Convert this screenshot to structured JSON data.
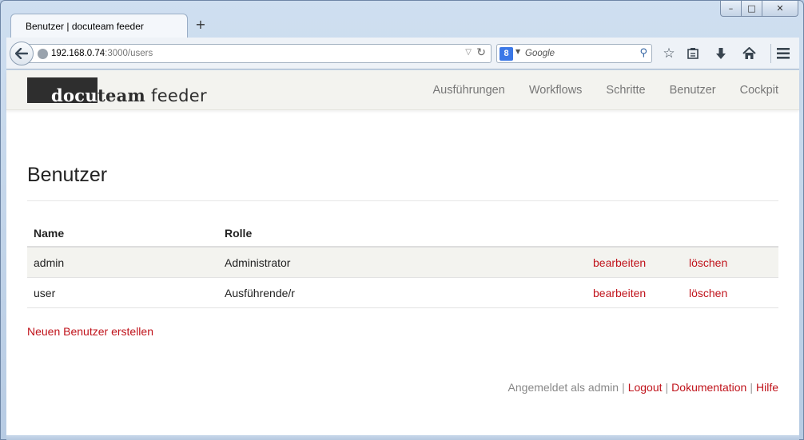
{
  "browser": {
    "tab_title": "Benutzer | docuteam feeder",
    "new_tab_icon": "plus-icon",
    "url_host": "192.168.0.74",
    "url_path": ":3000/users",
    "search_placeholder": "Google",
    "search_engine_badge": "8",
    "caption": {
      "minimize": "–",
      "maximize": "□",
      "close": "✕"
    },
    "toolbar_icons": [
      "star-icon",
      "reading-list-icon",
      "download-icon",
      "home-icon",
      "menu-icon"
    ]
  },
  "site": {
    "logo": {
      "docu": "docu",
      "team": "team",
      "feeder": " feeder"
    },
    "nav": [
      {
        "label": "Ausführungen"
      },
      {
        "label": "Workflows"
      },
      {
        "label": "Schritte"
      },
      {
        "label": "Benutzer"
      },
      {
        "label": "Cockpit"
      }
    ]
  },
  "page": {
    "title": "Benutzer",
    "table": {
      "headers": {
        "name": "Name",
        "role": "Rolle"
      },
      "rows": [
        {
          "name": "admin",
          "role": "Administrator",
          "edit": "bearbeiten",
          "delete": "löschen"
        },
        {
          "name": "user",
          "role": "Ausführende/r",
          "edit": "bearbeiten",
          "delete": "löschen"
        }
      ]
    },
    "new_user_link": "Neuen Benutzer erstellen"
  },
  "footer": {
    "logged_in_as": "Angemeldet als admin",
    "logout": "Logout",
    "docs": "Dokumentation",
    "help": "Hilfe",
    "separator": "|"
  },
  "colors": {
    "link": "#c0131b",
    "navbar_bg": "#f3f3ef",
    "window_frame": "#b9cde5"
  }
}
